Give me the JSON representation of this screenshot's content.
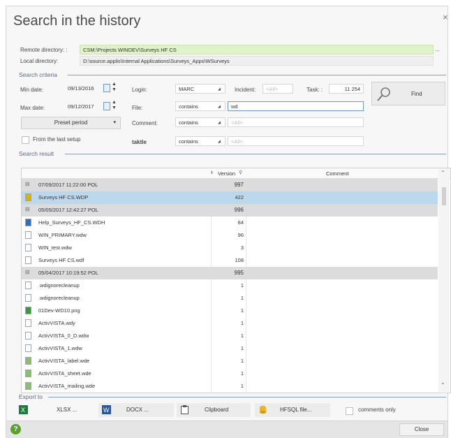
{
  "window": {
    "title": "Search in the history",
    "close_glyph": "×"
  },
  "remote_directory": {
    "label": "Remote directory: :",
    "value": "CSM:\\Projects WINDEV\\Surveys HF CS",
    "browse": "..."
  },
  "local_directory": {
    "label": "Local directory:",
    "value": "D:\\source.applis\\Internal Applications\\Surveys_Apps\\WSurveys"
  },
  "criteria": {
    "section_label": "Search criteria",
    "min_date": {
      "label": "Min date:",
      "value": "09/13/2016"
    },
    "max_date": {
      "label": "Max date:",
      "value": "09/12/2017"
    },
    "preset": {
      "label": "Preset period"
    },
    "from_last_setup": {
      "label": "From the last setup",
      "checked": false
    },
    "login": {
      "label": "Login:",
      "value": "MARC"
    },
    "incident": {
      "label": "Incident:",
      "placeholder": "<All>"
    },
    "task": {
      "label": "Task: :",
      "value": "11 254"
    },
    "file": {
      "label": "File:",
      "operator": "contains",
      "value": "wd"
    },
    "comment": {
      "label": "Comment:",
      "operator": "contains",
      "placeholder": "<All>"
    },
    "table": {
      "label": "taktle",
      "operator": "contains",
      "placeholder": "<All>"
    },
    "find_label": "Find"
  },
  "results": {
    "section_label": "Search result",
    "columns": {
      "version": "Version",
      "comment": "Comment"
    },
    "rows": [
      {
        "type": "group",
        "expander": "⊟",
        "text": "07/09/2017 11:22:00    POL",
        "version": "997"
      },
      {
        "type": "file",
        "icon": "wdp",
        "name": "Surveys HF CS.WDP",
        "version": "422",
        "selected": true
      },
      {
        "type": "group",
        "expander": "⊟",
        "text": "05/05/2017 12:42:27    POL",
        "version": "996"
      },
      {
        "type": "file",
        "icon": "wdh",
        "name": "Help_Surveys_HF_CS.WDH",
        "version": "84"
      },
      {
        "type": "file",
        "icon": "wdw",
        "name": "WIN_PRIMARY.wdw",
        "version": "96"
      },
      {
        "type": "file",
        "icon": "wdw",
        "name": "WIN_test.wdw",
        "version": "3"
      },
      {
        "type": "file",
        "icon": "blank",
        "name": "Surveys HF CS.wdf",
        "version": "108"
      },
      {
        "type": "group",
        "expander": "⊟",
        "text": "05/04/2017 10:19:52    POL",
        "version": "995"
      },
      {
        "type": "file",
        "icon": "blank",
        "name": ".wdignorecleanup",
        "version": "1"
      },
      {
        "type": "file",
        "icon": "blank",
        "name": ".wdignorecleanup",
        "version": "1"
      },
      {
        "type": "file",
        "icon": "png",
        "name": "01Dev-WD10.png",
        "version": "1"
      },
      {
        "type": "file",
        "icon": "wdw",
        "name": "ActivVISTA.wdy",
        "version": "1"
      },
      {
        "type": "file",
        "icon": "wdw",
        "name": "ActivVISTA_0_D.wdw",
        "version": "1"
      },
      {
        "type": "file",
        "icon": "wdw",
        "name": "ActivVISTA_1.wdw",
        "version": "1"
      },
      {
        "type": "file",
        "icon": "wde",
        "name": "ActivVISTA_label.wde",
        "version": "1"
      },
      {
        "type": "file",
        "icon": "wde",
        "name": "ActivVISTA_sheet.wde",
        "version": "1"
      },
      {
        "type": "file",
        "icon": "wde",
        "name": "ActivVISTA_mailing.wde",
        "version": "1"
      }
    ]
  },
  "export": {
    "section_label": "Export to",
    "xlsx": "XLSX ...",
    "docx": "DOCX ...",
    "clipboard": "Clipboard",
    "hfsql": "HFSQL file...",
    "comments_only": "comments only"
  },
  "footer": {
    "help": "?",
    "close": "Close"
  },
  "colors": {
    "accent_green": "#dff2c8",
    "selection": "#bcd8ec",
    "group_row": "#dcdcdc"
  }
}
